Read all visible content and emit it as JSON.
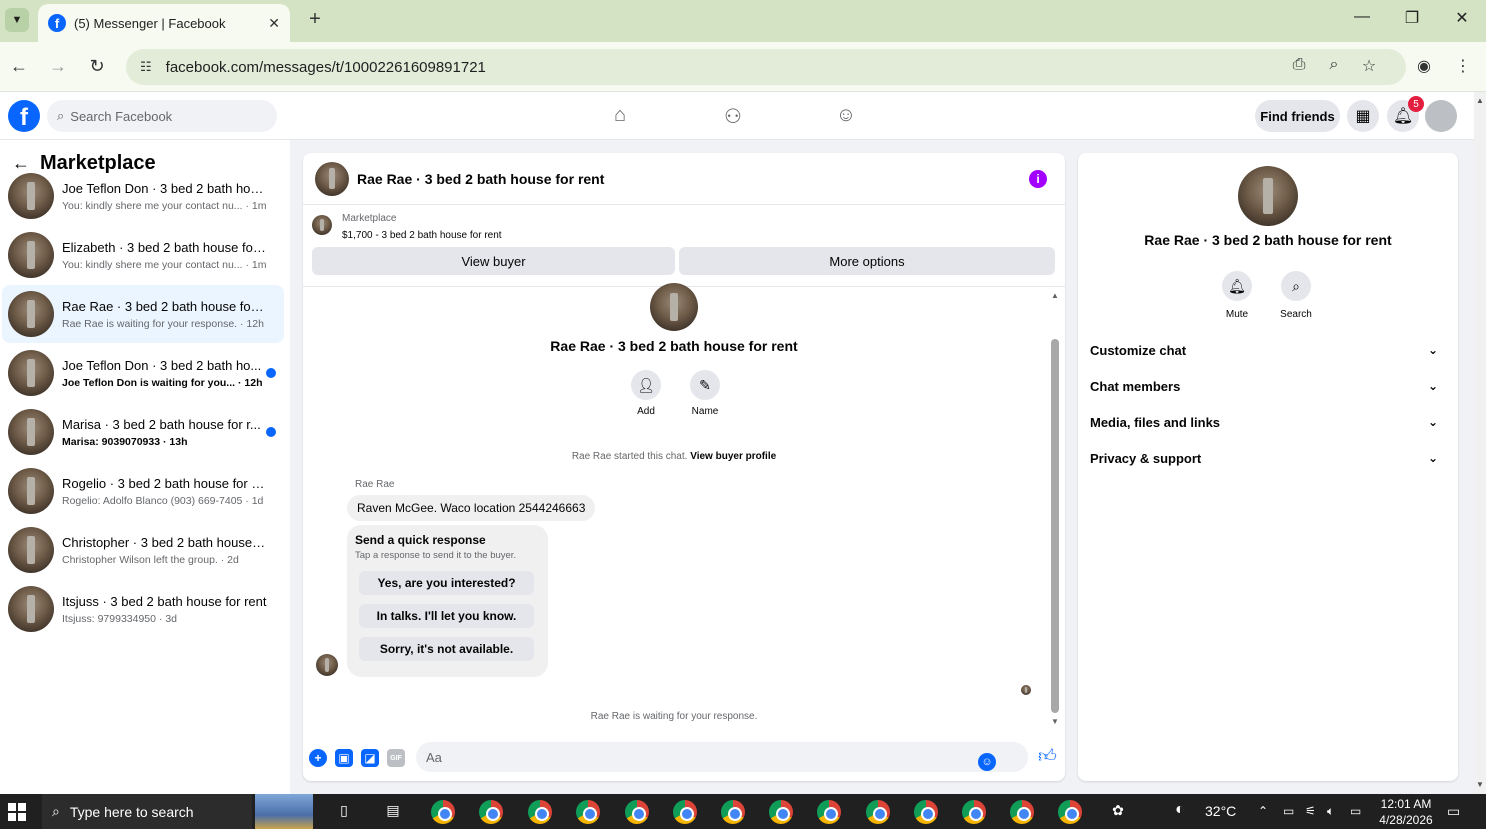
{
  "browser": {
    "tab_title": "(5) Messenger | Facebook",
    "url": "facebook.com/messages/t/10002261609891721",
    "icons": [
      "chevron-down-icon",
      "facebook-icon",
      "close-icon",
      "plus-icon",
      "back-icon",
      "forward-icon",
      "reload-icon",
      "tune-icon",
      "install-icon",
      "zoom-icon",
      "star-icon",
      "profile-icon",
      "menu-icon"
    ]
  },
  "fb": {
    "logo_letter": "f",
    "search_placeholder": "Search Facebook",
    "find_friends": "Find friends",
    "notif_count": "5"
  },
  "left": {
    "header": "Marketplace",
    "conversations": [
      {
        "name": "Joe Teflon Don · 3 bed 2 bath hou...",
        "sub": "You: kindly shere me your contact nu... · 1m",
        "unread": false
      },
      {
        "name": "Elizabeth · 3 bed 2 bath house for ...",
        "sub": "You: kindly shere me your contact nu... · 1m",
        "unread": false
      },
      {
        "name": "Rae Rae · 3 bed 2 bath house for r...",
        "sub": "Rae Rae is waiting for your response. · 12h",
        "unread": false
      },
      {
        "name": "Joe Teflon Don · 3 bed 2 bath ho...",
        "sub": "Joe Teflon Don is waiting for you... · 12h",
        "unread": true
      },
      {
        "name": "Marisa · 3 bed 2 bath house for r...",
        "sub": "Marisa: 9039070933 · 13h",
        "unread": true
      },
      {
        "name": "Rogelio · 3 bed 2 bath house for re...",
        "sub": "Rogelio: Adolfo Blanco (903) 669-7405 · 1d",
        "unread": false
      },
      {
        "name": "Christopher · 3 bed 2 bath house f...",
        "sub": "Christopher Wilson left the group. · 2d",
        "unread": false
      },
      {
        "name": "Itsjuss · 3 bed 2 bath house for rent",
        "sub": "Itsjuss: 9799334950 · 3d",
        "unread": false
      }
    ]
  },
  "chat": {
    "title": "Rae Rae · 3 bed 2 bath house for rent",
    "mp_label": "Marketplace",
    "mp_listing": "$1,700 - 3 bed 2 bath house for rent",
    "view_buyer": "View buyer",
    "more_options": "More options",
    "center_title": "Rae Rae · 3 bed 2 bath house for rent",
    "add_label": "Add",
    "name_label": "Name",
    "started_text": "Rae Rae started this chat.",
    "view_buyer_profile": "View buyer profile",
    "sender": "Rae Rae",
    "message": "Raven McGee. Waco location 2544246663",
    "qr_title": "Send a quick response",
    "qr_sub": "Tap a response to send it to the buyer.",
    "qr_options": [
      "Yes, are you interested?",
      "In talks. I'll let you know.",
      "Sorry, it's not available."
    ],
    "waiting": "Rae Rae is waiting for your response.",
    "composer_placeholder": "Aa"
  },
  "right": {
    "title": "Rae Rae · 3 bed 2 bath house for rent",
    "mute": "Mute",
    "search": "Search",
    "sections": [
      "Customize chat",
      "Chat members",
      "Media, files and links",
      "Privacy & support"
    ]
  },
  "taskbar": {
    "search_placeholder": "Type here to search",
    "temp": "32°C",
    "time": "12:01 AM",
    "date": "4/28/2026"
  },
  "colors": {
    "fb_blue": "#0866ff",
    "info_purple": "#a200ff",
    "badge_red": "#e41e3f",
    "tabbar_green": "#d3e3c3"
  }
}
